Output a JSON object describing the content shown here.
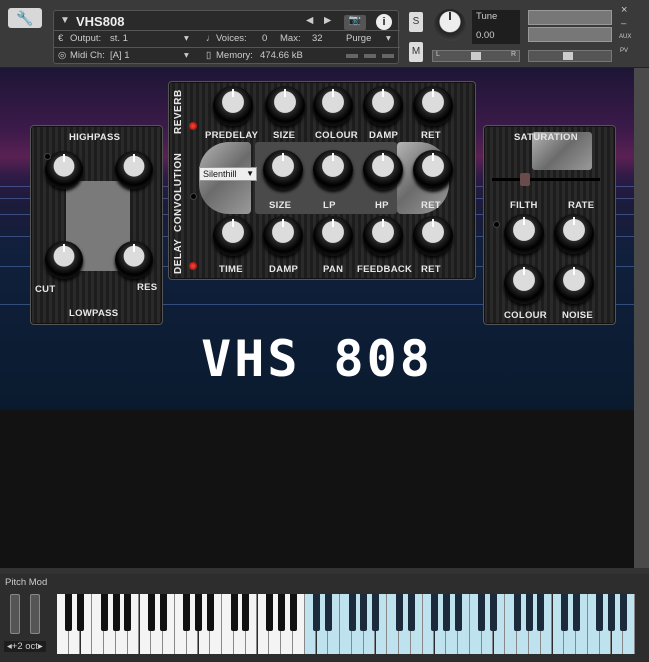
{
  "header": {
    "wrench_icon": "wrench-icon",
    "instrument_name": "VHS808",
    "output_label": "Output:",
    "output_value": "st. 1",
    "voices_label": "Voices:",
    "voices_value": "0",
    "max_label": "Max:",
    "max_value": "32",
    "purge_label": "Purge",
    "midi_label": "Midi Ch:",
    "midi_value": "[A]  1",
    "memory_label": "Memory:",
    "memory_value": "474.66 kB",
    "solo_label": "S",
    "mute_label": "M",
    "tune_label": "Tune",
    "tune_value": "0.00",
    "pan_left": "L",
    "pan_right": "R",
    "aux_label": "AUX",
    "pv_label": "PV",
    "close_label": "×",
    "min_label": "–"
  },
  "reverb": {
    "title": "REVERB",
    "knobs": [
      "PREDELAY",
      "SIZE",
      "COLOUR",
      "DAMP",
      "RET"
    ]
  },
  "convolution": {
    "title": "CONVOLUTION",
    "preset": "Silenthill",
    "knobs": [
      "SIZE",
      "LP",
      "HP",
      "RET"
    ]
  },
  "delay": {
    "title": "DELAY",
    "knobs": [
      "TIME",
      "DAMP",
      "PAN",
      "FEEDBACK",
      "RET"
    ]
  },
  "filter": {
    "top_title": "HIGHPASS",
    "bottom_title": "LOWPASS",
    "cut_label": "CUT",
    "res_label": "RES"
  },
  "saturation": {
    "title": "SATURATION",
    "knobs": [
      "FILTH",
      "RATE",
      "COLOUR",
      "NOISE"
    ]
  },
  "main_title": "VHS 808",
  "keyboard": {
    "pitch_mod_label": "Pitch Mod",
    "octave_label": "+2 oct"
  }
}
